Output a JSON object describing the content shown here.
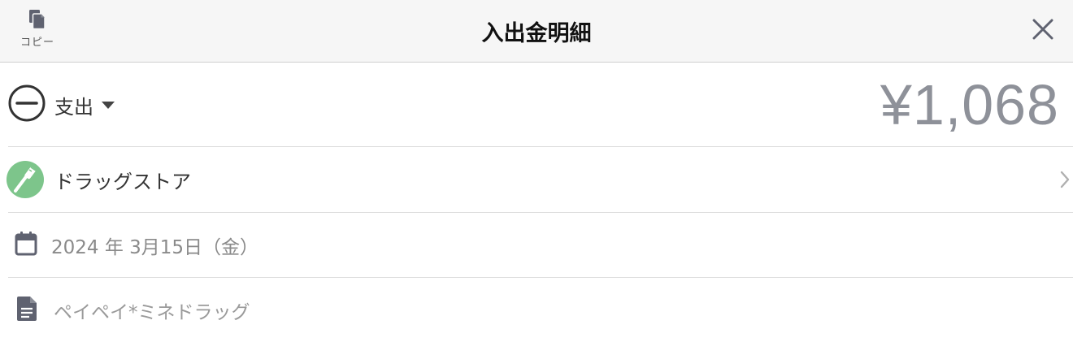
{
  "header": {
    "copy_label": "コピー",
    "title": "入出金明細"
  },
  "transaction": {
    "type_label": "支出",
    "amount": "¥1,068",
    "category": "ドラッグストア",
    "date": "2024 年 3月15日（金）",
    "memo": "ペイペイ*ミネドラッグ"
  },
  "colors": {
    "amount": "#8e9199",
    "category_icon_bg": "#7dc58b",
    "icon_gray": "#5f6270"
  },
  "icons": {
    "copy": "copy-icon",
    "close": "close-icon",
    "type": "minus-circle-icon",
    "caret": "caret-down-icon",
    "category": "toothbrush-icon",
    "chevron": "chevron-right-icon",
    "date": "calendar-icon",
    "memo": "document-icon"
  }
}
